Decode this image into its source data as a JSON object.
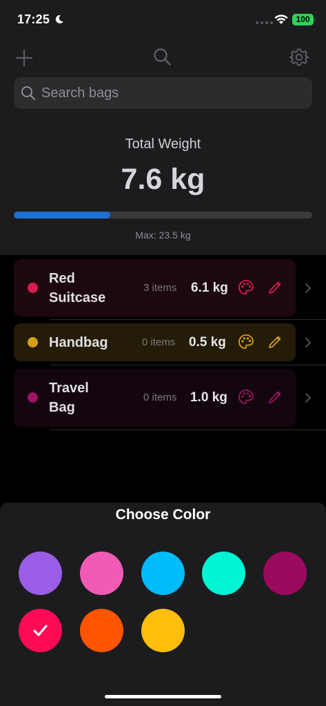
{
  "status_bar": {
    "time": "17:25",
    "battery": "100"
  },
  "header": {
    "search": {
      "placeholder": "Search bags",
      "value": ""
    },
    "total_label": "Total Weight",
    "total_value": "7.6 kg",
    "progress_fraction": 0.3234,
    "max_label": "Max: 23.5 kg"
  },
  "bags": [
    {
      "name": "Red\nSuitcase",
      "items": "3 items",
      "weight": "6.1 kg",
      "color": "#d81b50",
      "row_bg": "#1e0810"
    },
    {
      "name": "Handbag",
      "items": "0 items",
      "weight": "0.5 kg",
      "color": "#d4a017",
      "row_bg": "#241c06"
    },
    {
      "name": "Travel\nBag",
      "items": "0 items",
      "weight": "1.0 kg",
      "color": "#9e1466",
      "row_bg": "#14060e"
    }
  ],
  "color_sheet": {
    "title": "Choose Color",
    "selected_index": 5,
    "colors": [
      "#9b5de5",
      "#f25bb5",
      "#00bbf9",
      "#00f5d4",
      "#9b0a5e",
      "#ff0a55",
      "#ff5400",
      "#ffbe0b"
    ]
  }
}
